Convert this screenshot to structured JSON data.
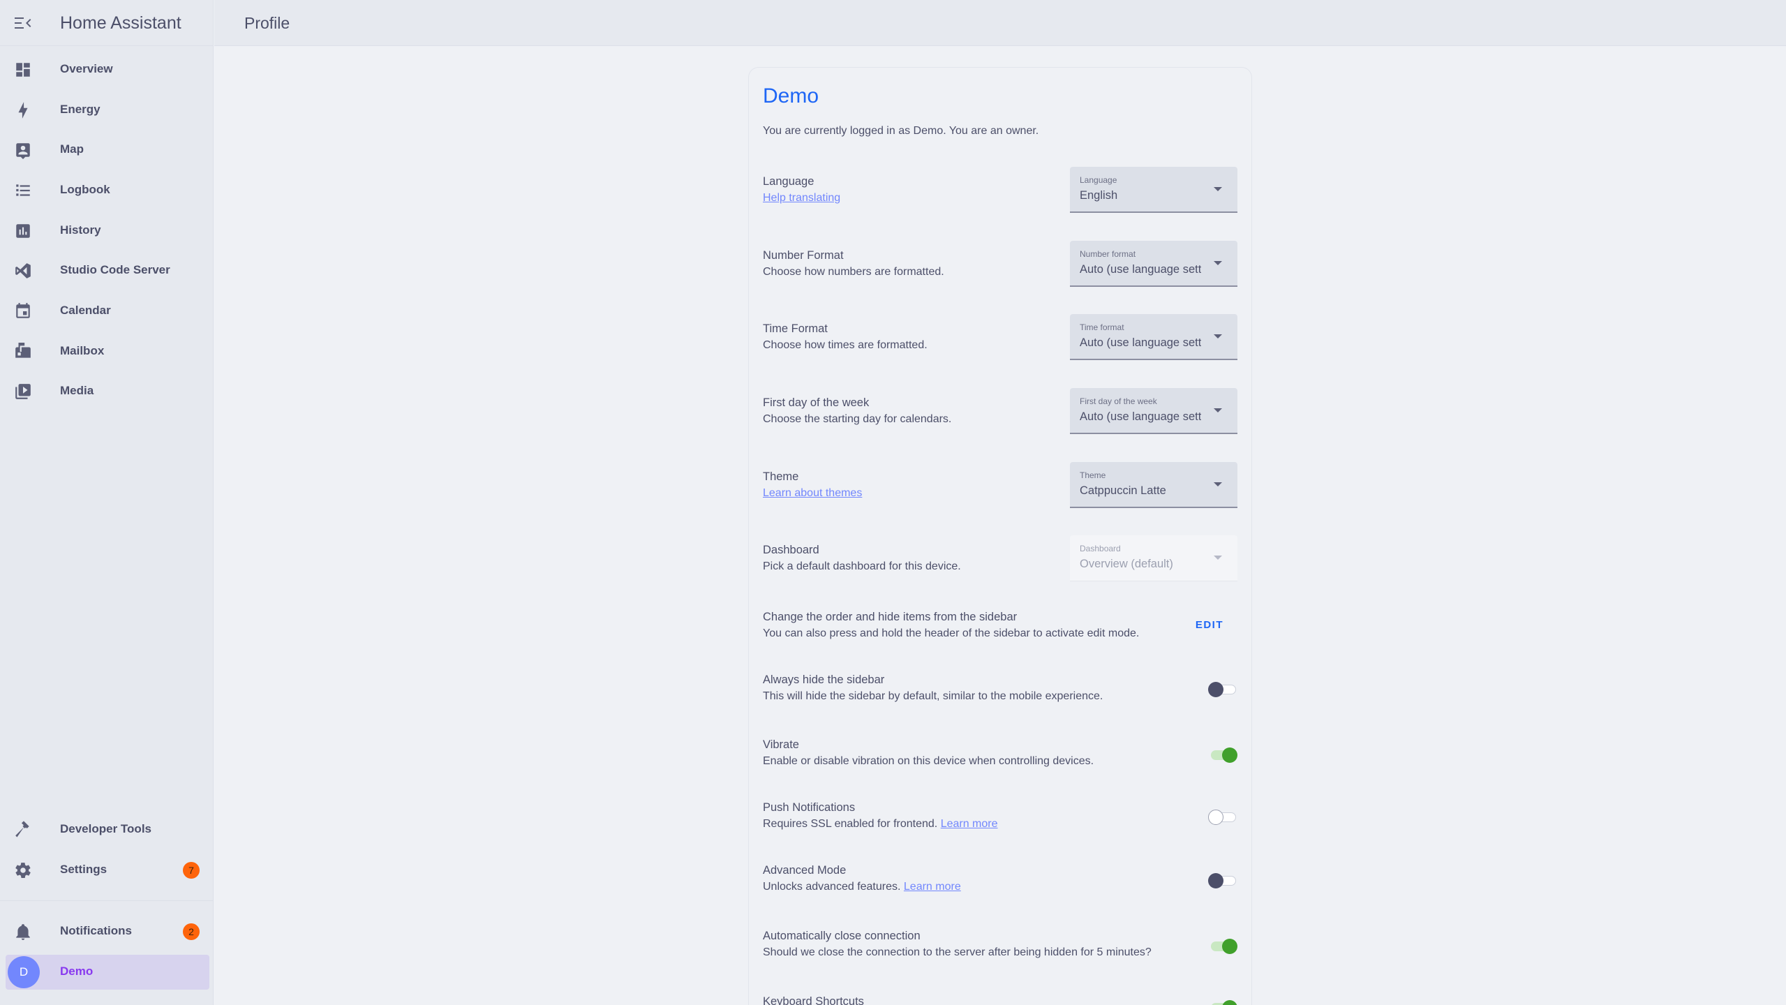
{
  "app": {
    "title": "Home Assistant"
  },
  "topbar": {
    "title": "Profile"
  },
  "sidebar": {
    "items": [
      {
        "label": "Overview",
        "icon": "dashboard-icon"
      },
      {
        "label": "Energy",
        "icon": "lightning-bolt-icon"
      },
      {
        "label": "Map",
        "icon": "map-icon"
      },
      {
        "label": "Logbook",
        "icon": "list-icon"
      },
      {
        "label": "History",
        "icon": "chart-bar-icon"
      },
      {
        "label": "Studio Code Server",
        "icon": "vscode-icon"
      },
      {
        "label": "Calendar",
        "icon": "calendar-icon"
      },
      {
        "label": "Mailbox",
        "icon": "mailbox-icon"
      },
      {
        "label": "Media",
        "icon": "play-box-icon"
      }
    ],
    "developer_tools": "Developer Tools",
    "settings": {
      "label": "Settings",
      "badge": "7"
    },
    "notifications": {
      "label": "Notifications",
      "badge": "2"
    },
    "user": {
      "label": "Demo",
      "initial": "D"
    }
  },
  "profile": {
    "name": "Demo",
    "logged_in_text": "You are currently logged in as Demo. You are an owner.",
    "language": {
      "heading": "Language",
      "link": "Help translating",
      "select_label": "Language",
      "value": "English"
    },
    "number_format": {
      "heading": "Number Format",
      "description": "Choose how numbers are formatted.",
      "select_label": "Number format",
      "value": "Auto (use language setting)"
    },
    "time_format": {
      "heading": "Time Format",
      "description": "Choose how times are formatted.",
      "select_label": "Time format",
      "value": "Auto (use language setting)"
    },
    "first_day": {
      "heading": "First day of the week",
      "description": "Choose the starting day for calendars.",
      "select_label": "First day of the week",
      "value": "Auto (use language setting)"
    },
    "theme": {
      "heading": "Theme",
      "link": "Learn about themes",
      "select_label": "Theme",
      "value": "Catppuccin Latte"
    },
    "dashboard": {
      "heading": "Dashboard",
      "description": "Pick a default dashboard for this device.",
      "select_label": "Dashboard",
      "value": "Overview (default)"
    },
    "sidebar_order": {
      "heading": "Change the order and hide items from the sidebar",
      "description": "You can also press and hold the header of the sidebar to activate edit mode.",
      "button": "EDIT"
    },
    "hide_sidebar": {
      "heading": "Always hide the sidebar",
      "description": "This will hide the sidebar by default, similar to the mobile experience.",
      "checked": false
    },
    "vibrate": {
      "heading": "Vibrate",
      "description": "Enable or disable vibration on this device when controlling devices.",
      "checked": true
    },
    "push": {
      "heading": "Push Notifications",
      "description": "Requires SSL enabled for frontend.",
      "link": "Learn more",
      "checked": false
    },
    "advanced": {
      "heading": "Advanced Mode",
      "description": "Unlocks advanced features.",
      "link": "Learn more",
      "checked": false
    },
    "auto_close": {
      "heading": "Automatically close connection",
      "description": "Should we close the connection to the server after being hidden for 5 minutes?",
      "checked": true
    },
    "keyboard": {
      "heading": "Keyboard Shortcuts"
    }
  },
  "colors": {
    "accent": "#1e66f5",
    "switch_on": "#40a02b",
    "badge": "#fe640b",
    "active_bg": "#d7d3ee",
    "active_text": "#8839ef"
  }
}
